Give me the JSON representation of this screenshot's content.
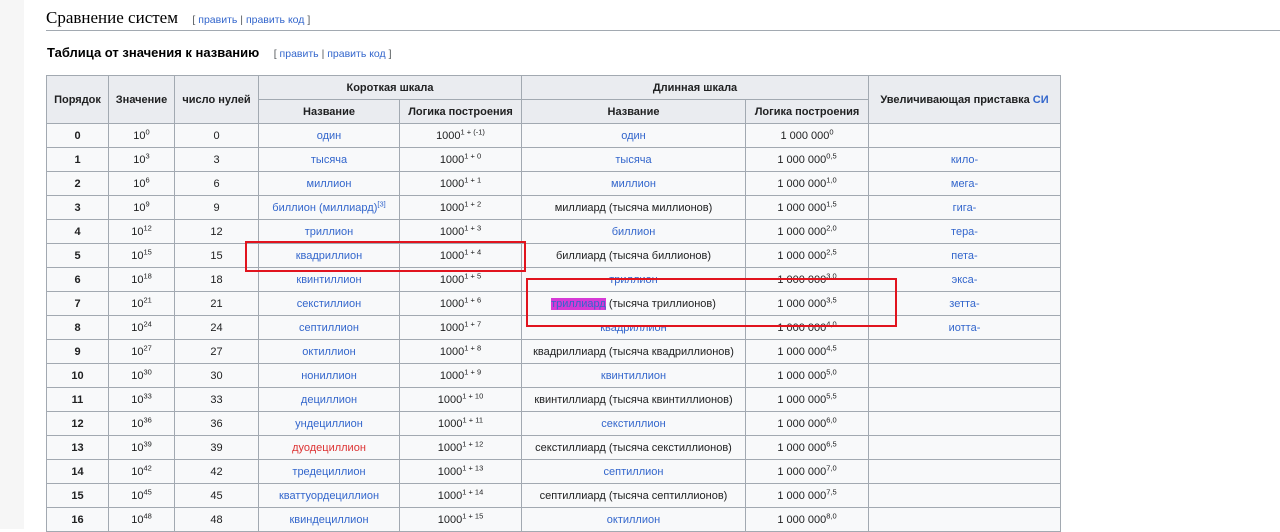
{
  "section": {
    "title": "Сравнение систем",
    "edit_open": "[",
    "edit_link": "править",
    "edit_sep": "|",
    "edit_code_link": "править код",
    "edit_close": "]"
  },
  "subsection": {
    "title": "Таблица от значения к названию",
    "edit_open": "[",
    "edit_link": "править",
    "edit_sep": "|",
    "edit_code_link": "править код",
    "edit_close": "]"
  },
  "table": {
    "headers": {
      "order": "Порядок",
      "value": "Значение",
      "zeros": "число нулей",
      "short_scale": "Короткая шкала",
      "long_scale": "Длинная шкала",
      "name": "Название",
      "logic": "Логика построения",
      "si_prefix": "Увеличивающая приставка",
      "si_link": "СИ"
    },
    "rows": [
      {
        "order": "0",
        "base": "10",
        "exp": "0",
        "zeros": "0",
        "short_name": "один",
        "short_red": false,
        "short_logic_base": "1000",
        "short_logic_exp": "1 + (-1)",
        "long_name": "один",
        "long_is_link": true,
        "long_logic_base": "1 000 000",
        "long_logic_exp": "0",
        "si": ""
      },
      {
        "order": "1",
        "base": "10",
        "exp": "3",
        "zeros": "3",
        "short_name": "тысяча",
        "short_red": false,
        "short_logic_base": "1000",
        "short_logic_exp": "1 + 0",
        "long_name": "тысяча",
        "long_is_link": true,
        "long_logic_base": "1 000 000",
        "long_logic_exp": "0,5",
        "si": "кило-"
      },
      {
        "order": "2",
        "base": "10",
        "exp": "6",
        "zeros": "6",
        "short_name": "миллион",
        "short_red": false,
        "short_logic_base": "1000",
        "short_logic_exp": "1 + 1",
        "long_name": "миллион",
        "long_is_link": true,
        "long_logic_base": "1 000 000",
        "long_logic_exp": "1,0",
        "si": "мега-"
      },
      {
        "order": "3",
        "base": "10",
        "exp": "9",
        "zeros": "9",
        "short_name": "биллион (миллиард)",
        "short_ref": "[3]",
        "short_red": false,
        "short_logic_base": "1000",
        "short_logic_exp": "1 + 2",
        "long_name": "миллиард (тысяча миллионов)",
        "long_is_link": false,
        "long_logic_base": "1 000 000",
        "long_logic_exp": "1,5",
        "si": "гига-"
      },
      {
        "order": "4",
        "base": "10",
        "exp": "12",
        "zeros": "12",
        "short_name": "триллион",
        "short_red": false,
        "short_logic_base": "1000",
        "short_logic_exp": "1 + 3",
        "long_name": "биллион",
        "long_is_link": true,
        "long_logic_base": "1 000 000",
        "long_logic_exp": "2,0",
        "si": "тера-"
      },
      {
        "order": "5",
        "base": "10",
        "exp": "15",
        "zeros": "15",
        "short_name": "квадриллион",
        "short_red": false,
        "short_logic_base": "1000",
        "short_logic_exp": "1 + 4",
        "long_name": "биллиард (тысяча биллионов)",
        "long_is_link": false,
        "long_logic_base": "1 000 000",
        "long_logic_exp": "2,5",
        "si": "пета-"
      },
      {
        "order": "6",
        "base": "10",
        "exp": "18",
        "zeros": "18",
        "short_name": "квинтиллион",
        "short_red": false,
        "short_logic_base": "1000",
        "short_logic_exp": "1 + 5",
        "long_name": "триллион",
        "long_is_link": true,
        "long_logic_base": "1 000 000",
        "long_logic_exp": "3,0",
        "si": "экса-"
      },
      {
        "order": "7",
        "base": "10",
        "exp": "21",
        "zeros": "21",
        "short_name": "секстиллион",
        "short_red": false,
        "short_logic_base": "1000",
        "short_logic_exp": "1 + 6",
        "long_name_highlight": "триллиард",
        "long_name": " (тысяча триллионов)",
        "long_is_link": false,
        "long_logic_base": "1 000 000",
        "long_logic_exp": "3,5",
        "si": "зетта-"
      },
      {
        "order": "8",
        "base": "10",
        "exp": "24",
        "zeros": "24",
        "short_name": "септиллион",
        "short_red": false,
        "short_logic_base": "1000",
        "short_logic_exp": "1 + 7",
        "long_name": "квадриллион",
        "long_is_link": true,
        "long_logic_base": "1 000 000",
        "long_logic_exp": "4,0",
        "si": "иотта-"
      },
      {
        "order": "9",
        "base": "10",
        "exp": "27",
        "zeros": "27",
        "short_name": "октиллион",
        "short_red": false,
        "short_logic_base": "1000",
        "short_logic_exp": "1 + 8",
        "long_name": "квадриллиард (тысяча квадриллионов)",
        "long_is_link": false,
        "long_logic_base": "1 000 000",
        "long_logic_exp": "4,5",
        "si": ""
      },
      {
        "order": "10",
        "base": "10",
        "exp": "30",
        "zeros": "30",
        "short_name": "нониллион",
        "short_red": false,
        "short_logic_base": "1000",
        "short_logic_exp": "1 + 9",
        "long_name": "квинтиллион",
        "long_is_link": true,
        "long_logic_base": "1 000 000",
        "long_logic_exp": "5,0",
        "si": ""
      },
      {
        "order": "11",
        "base": "10",
        "exp": "33",
        "zeros": "33",
        "short_name": "дециллион",
        "short_red": false,
        "short_logic_base": "1000",
        "short_logic_exp": "1 + 10",
        "long_name": "квинтиллиард (тысяча квинтиллионов)",
        "long_is_link": false,
        "long_logic_base": "1 000 000",
        "long_logic_exp": "5,5",
        "si": ""
      },
      {
        "order": "12",
        "base": "10",
        "exp": "36",
        "zeros": "36",
        "short_name": "ундециллион",
        "short_red": false,
        "short_logic_base": "1000",
        "short_logic_exp": "1 + 11",
        "long_name": "секстиллион",
        "long_is_link": true,
        "long_logic_base": "1 000 000",
        "long_logic_exp": "6,0",
        "si": ""
      },
      {
        "order": "13",
        "base": "10",
        "exp": "39",
        "zeros": "39",
        "short_name": "дуодециллион",
        "short_red": true,
        "short_logic_base": "1000",
        "short_logic_exp": "1 + 12",
        "long_name": "секстиллиард (тысяча секстиллионов)",
        "long_is_link": false,
        "long_logic_base": "1 000 000",
        "long_logic_exp": "6,5",
        "si": ""
      },
      {
        "order": "14",
        "base": "10",
        "exp": "42",
        "zeros": "42",
        "short_name": "тредециллион",
        "short_red": false,
        "short_logic_base": "1000",
        "short_logic_exp": "1 + 13",
        "long_name": "септиллион",
        "long_is_link": true,
        "long_logic_base": "1 000 000",
        "long_logic_exp": "7,0",
        "si": ""
      },
      {
        "order": "15",
        "base": "10",
        "exp": "45",
        "zeros": "45",
        "short_name": "кваттуордециллион",
        "short_red": false,
        "short_logic_base": "1000",
        "short_logic_exp": "1 + 14",
        "long_name": "септиллиард (тысяча септиллионов)",
        "long_is_link": false,
        "long_logic_base": "1 000 000",
        "long_logic_exp": "7,5",
        "si": ""
      },
      {
        "order": "16",
        "base": "10",
        "exp": "48",
        "zeros": "48",
        "short_name": "квиндециллион",
        "short_red": false,
        "short_logic_base": "1000",
        "short_logic_exp": "1 + 15",
        "long_name": "октиллион",
        "long_is_link": true,
        "long_logic_base": "1 000 000",
        "long_logic_exp": "8,0",
        "si": ""
      }
    ]
  },
  "annotation_color": "#e1141e",
  "highlight_color": "#d63ad6",
  "link_color": "#3366cc",
  "redlink_color": "#dd3333"
}
